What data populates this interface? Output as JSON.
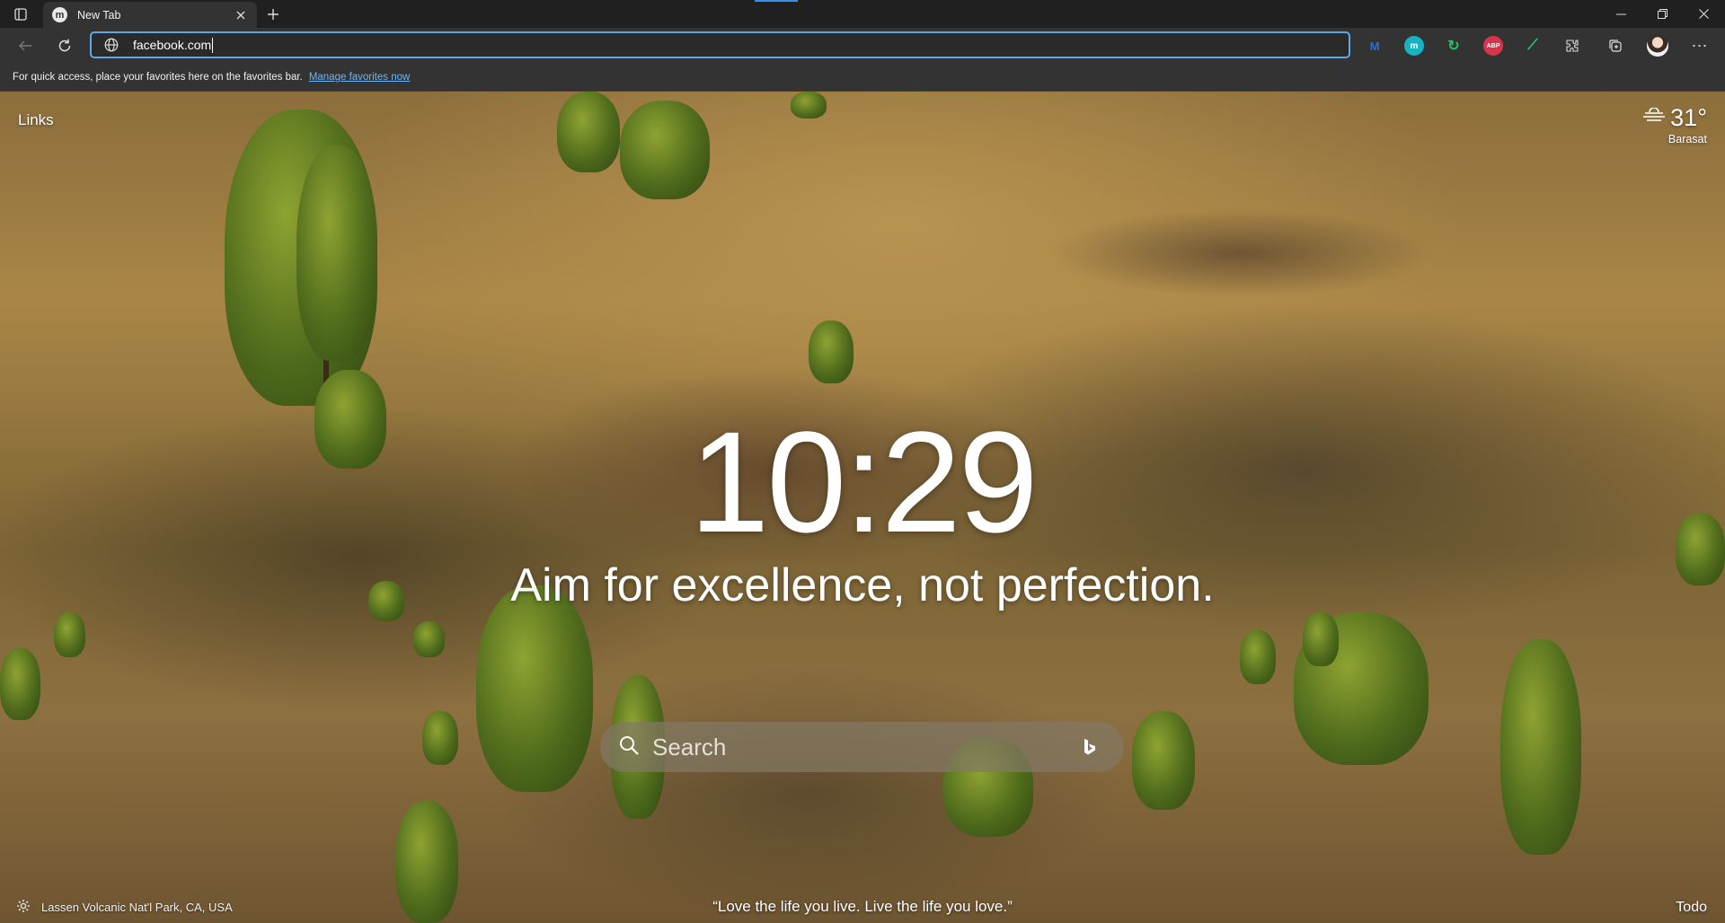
{
  "tab": {
    "favicon": "m",
    "title": "New Tab"
  },
  "omnibox": {
    "value": "facebook.com"
  },
  "extensions": [
    {
      "name": "m-shield-extension-icon",
      "glyph": "M",
      "color": "#2b6fd6"
    },
    {
      "name": "m-circle-extension-icon",
      "glyph": "m",
      "color": "#17b3c1"
    },
    {
      "name": "green-refresh-extension-icon",
      "glyph": "↻",
      "color": "#22c06b"
    },
    {
      "name": "adblock-plus-extension-icon",
      "glyph": "ABP",
      "color": "#d8344b"
    },
    {
      "name": "trend-extension-icon",
      "glyph": "⟋",
      "color": "#1fd17a"
    }
  ],
  "favorites_bar": {
    "message": "For quick access, place your favorites here on the favorites bar.",
    "link": "Manage favorites now"
  },
  "newtab": {
    "links_label": "Links",
    "weather": {
      "temperature": "31°",
      "city": "Barasat"
    },
    "clock": "10:29",
    "main_quote": "Aim for excellence, not perfection.",
    "search_placeholder": "Search",
    "location": "Lassen Volcanic Nat'l Park, CA, USA",
    "footer_quote": "“Love the life you live. Live the life you love.”",
    "todo_label": "Todo"
  }
}
